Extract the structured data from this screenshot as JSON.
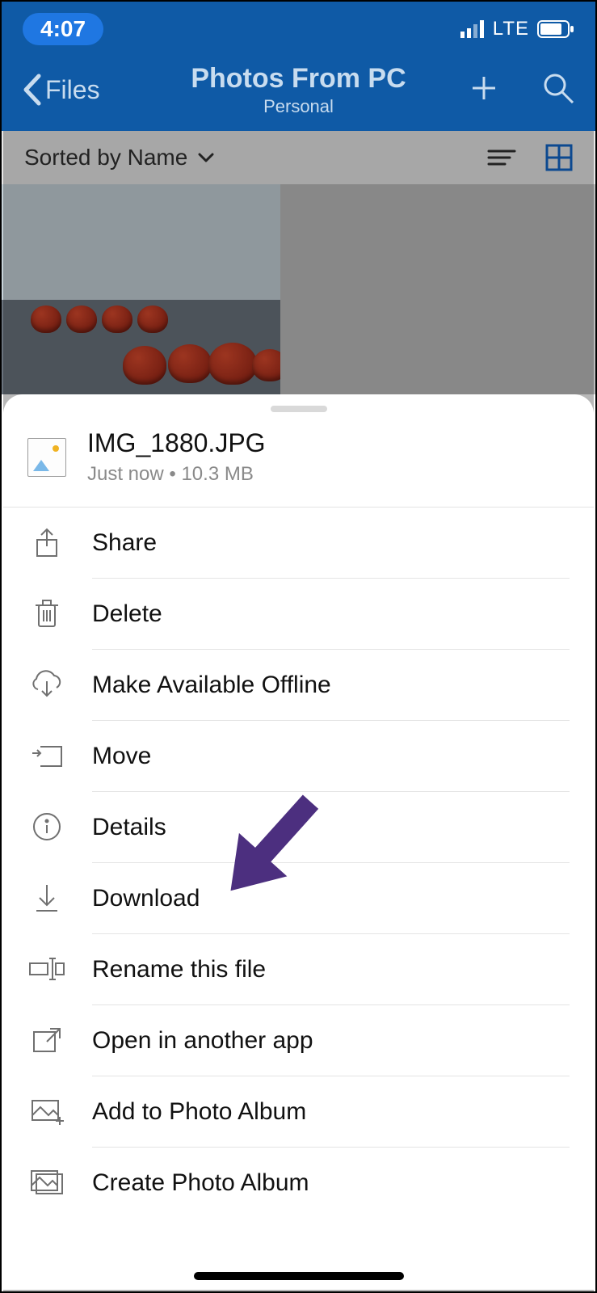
{
  "statusbar": {
    "time": "4:07",
    "network": "LTE"
  },
  "navbar": {
    "back_label": "Files",
    "title": "Photos From PC",
    "subtitle": "Personal"
  },
  "sortbar": {
    "text": "Sorted by Name"
  },
  "sheet": {
    "file_name": "IMG_1880.JPG",
    "file_meta": "Just now • 10.3 MB",
    "menu": {
      "share": "Share",
      "delete": "Delete",
      "offline": "Make Available Offline",
      "move": "Move",
      "details": "Details",
      "download": "Download",
      "rename": "Rename this file",
      "openin": "Open in another app",
      "addalbum": "Add to Photo Album",
      "createalbum": "Create Photo Album"
    }
  }
}
